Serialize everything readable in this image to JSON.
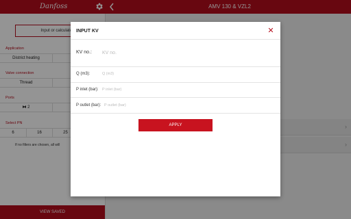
{
  "header": {
    "logo_text": "Danfoss",
    "title": "AMV 130 & VZL2",
    "gear_icon": "gear-icon",
    "back_icon": "chevron-left-icon",
    "brand_color": "#b40d1c"
  },
  "left_panel": {
    "calc_button_label": "Input or calculate KV",
    "application": {
      "label": "Application",
      "options": [
        "District heating",
        ""
      ]
    },
    "valve_connection": {
      "label": "Valve connection",
      "options": [
        "Thread",
        ""
      ]
    },
    "ports": {
      "label": "Ports",
      "options": [
        "2",
        ""
      ],
      "icon": "valve-icon"
    },
    "select_pn": {
      "label": "Select PN",
      "options": [
        "6",
        "16",
        "25",
        ""
      ]
    },
    "note": "If no filters are chosen, all will",
    "view_saved_label": "VIEW SAVED"
  },
  "dialog": {
    "title": "INPUT KV",
    "close_icon": "close-icon",
    "kv": {
      "label": "KV no.:",
      "placeholder": "KV no."
    },
    "q": {
      "label": "Q (m3):",
      "placeholder": "Q (m3)"
    },
    "p_inlet": {
      "label": "P inlet (bar):",
      "placeholder": "P inlet (bar)"
    },
    "p_outlet": {
      "label": "P outlet (bar):",
      "placeholder": "P outlet (bar)"
    },
    "apply_label": "APPLY"
  }
}
